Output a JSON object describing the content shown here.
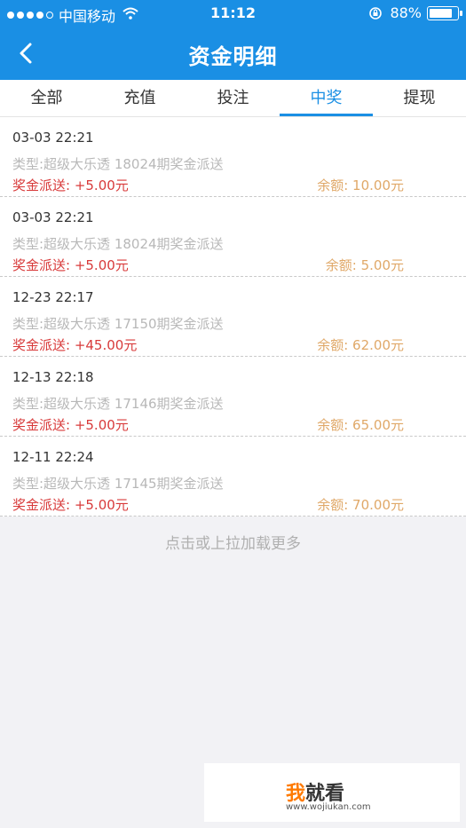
{
  "status_bar": {
    "carrier": "中国移动",
    "time": "11:12",
    "battery": "88%",
    "battery_level": 0.88,
    "icons": [
      "signal-icon",
      "wifi-icon",
      "rotation-lock-icon",
      "battery-icon"
    ]
  },
  "nav": {
    "title": "资金明细",
    "back_icon": "chevron-left-icon"
  },
  "tabs": [
    {
      "label": "全部"
    },
    {
      "label": "充值"
    },
    {
      "label": "投注"
    },
    {
      "label": "中奖",
      "active": true
    },
    {
      "label": "提现"
    }
  ],
  "records": [
    {
      "time": "03-03 22:21",
      "type": "类型:超级大乐透 18024期奖金派送",
      "amount": "奖金派送: +5.00元",
      "balance": "余额: 10.00元"
    },
    {
      "time": "03-03 22:21",
      "type": "类型:超级大乐透 18024期奖金派送",
      "amount": "奖金派送: +5.00元",
      "balance": "余额: 5.00元"
    },
    {
      "time": "12-23 22:17",
      "type": "类型:超级大乐透 17150期奖金派送",
      "amount": "奖金派送: +45.00元",
      "balance": "余额: 62.00元"
    },
    {
      "time": "12-13 22:18",
      "type": "类型:超级大乐透 17146期奖金派送",
      "amount": "奖金派送: +5.00元",
      "balance": "余额: 65.00元"
    },
    {
      "time": "12-11 22:24",
      "type": "类型:超级大乐透 17145期奖金派送",
      "amount": "奖金派送: +5.00元",
      "balance": "余额: 70.00元"
    }
  ],
  "load_more": "点击或上拉加载更多",
  "watermark": {
    "logo_first": "我",
    "logo_rest": "就看",
    "url": "www.wojiukan.com"
  },
  "colors": {
    "primary": "#1a8fe4",
    "amount": "#d83a3a",
    "balance": "#e0a868",
    "type_text": "#b8b8b8"
  }
}
